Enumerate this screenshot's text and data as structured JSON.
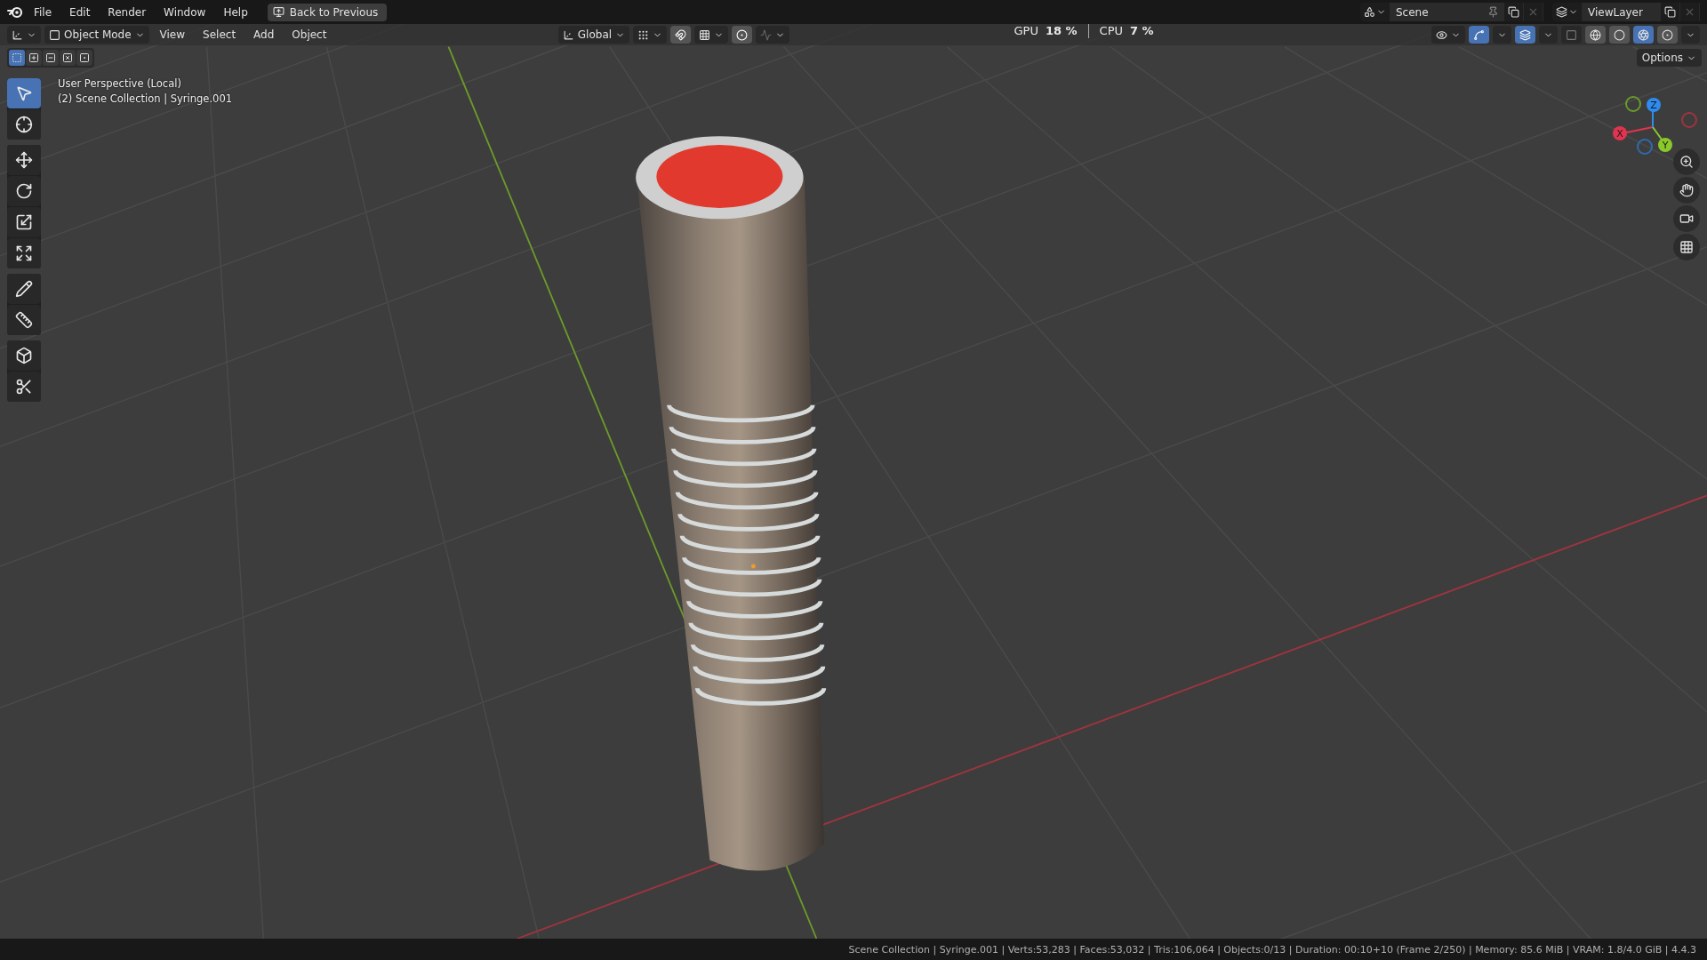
{
  "top_bar": {
    "menus": [
      "File",
      "Edit",
      "Render",
      "Window",
      "Help"
    ],
    "back_button": "Back to Previous",
    "scene": "Scene",
    "view_layer": "ViewLayer"
  },
  "header": {
    "mode": "Object Mode",
    "menus": [
      "View",
      "Select",
      "Add",
      "Object"
    ],
    "orientation": "Global",
    "options": "Options",
    "toggles": [
      {
        "kind": "snap",
        "on": true
      },
      {
        "kind": "proportional",
        "on": true
      },
      {
        "kind": "gizmos",
        "on": true
      },
      {
        "kind": "overlays",
        "on": true
      },
      {
        "kind": "xray",
        "on": false
      }
    ],
    "shading": [
      {
        "kind": "wireframe",
        "selected": false
      },
      {
        "kind": "solid",
        "selected": false
      },
      {
        "kind": "material",
        "selected": true
      },
      {
        "kind": "rendered",
        "selected": false
      }
    ]
  },
  "stats": [
    {
      "label": "GPU",
      "value": "18 %"
    },
    {
      "label": "CPU",
      "value": "7 %"
    }
  ],
  "select_modes": [
    {
      "kind": "new",
      "selected": true
    },
    {
      "kind": "extend",
      "selected": false
    },
    {
      "kind": "subtract",
      "selected": false
    },
    {
      "kind": "invert",
      "selected": false
    },
    {
      "kind": "intersect",
      "selected": false
    }
  ],
  "viewport_info": [
    "User Perspective (Local)",
    "(2) Scene Collection | Syringe.001"
  ],
  "tool_groups": [
    {
      "tools": [
        {
          "kind": "select",
          "selected": true
        },
        {
          "kind": "cursor",
          "selected": false
        }
      ]
    },
    {
      "tools": [
        {
          "kind": "move",
          "selected": false
        },
        {
          "kind": "rotate",
          "selected": false
        },
        {
          "kind": "scale",
          "selected": false
        },
        {
          "kind": "transform",
          "selected": false
        }
      ]
    },
    {
      "tools": [
        {
          "kind": "annotate",
          "selected": false
        },
        {
          "kind": "measure",
          "selected": false
        }
      ]
    },
    {
      "tools": [
        {
          "kind": "add-cube",
          "selected": false
        },
        {
          "kind": "cut",
          "selected": false
        }
      ]
    }
  ],
  "axes": [
    {
      "label": "X",
      "color": "#e0344f"
    },
    {
      "label": "Y",
      "color": "#8bc92a"
    },
    {
      "label": "Z",
      "color": "#2e8cf0"
    }
  ],
  "status_bar": "Scene Collection | Syringe.001 | Verts:53,283 | Faces:53,032 | Tris:106,064 | Objects:0/13 | Duration: 00:10+10 (Frame 2/250) | Memory: 85.6 MiB | VRAM: 1.8/4.0 GiB | 4.4.3"
}
